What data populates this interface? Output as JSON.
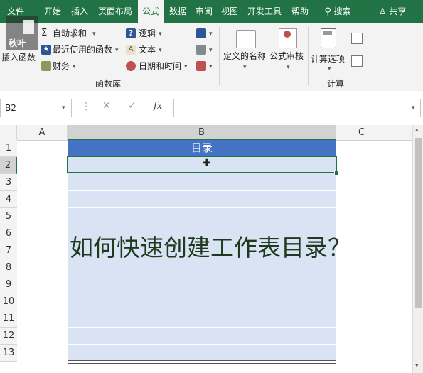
{
  "tabs": [
    "文件",
    "开始",
    "插入",
    "页面布局",
    "公式",
    "数据",
    "审阅",
    "视图",
    "开发工具",
    "帮助"
  ],
  "search_label": "搜索",
  "share_label": "共享",
  "logo_text": "秋叶",
  "ribbon": {
    "insert_function": "插入函数",
    "autosum": "自动求和",
    "recent": "最近使用的函数",
    "financial": "财务",
    "logical": "逻辑",
    "text": "文本",
    "datetime": "日期和时间",
    "define_name": "定义的名称",
    "formula_audit": "公式审核",
    "calc_options": "计算选项",
    "group_library": "函数库",
    "group_calc": "计算"
  },
  "formula_bar": {
    "name_box": "B2",
    "fx": "fx",
    "value": ""
  },
  "sheet": {
    "columns": [
      "A",
      "B",
      "C"
    ],
    "rows": [
      "1",
      "2",
      "3",
      "4",
      "5",
      "6",
      "7",
      "8",
      "9",
      "10",
      "11",
      "12",
      "13"
    ],
    "header_cell": "目录",
    "overlay_title": "如何快速创建工作表目录？"
  },
  "colors": {
    "ribbon_green": "#217346",
    "table_header": "#4472c4",
    "table_band": "#dae3f3"
  }
}
